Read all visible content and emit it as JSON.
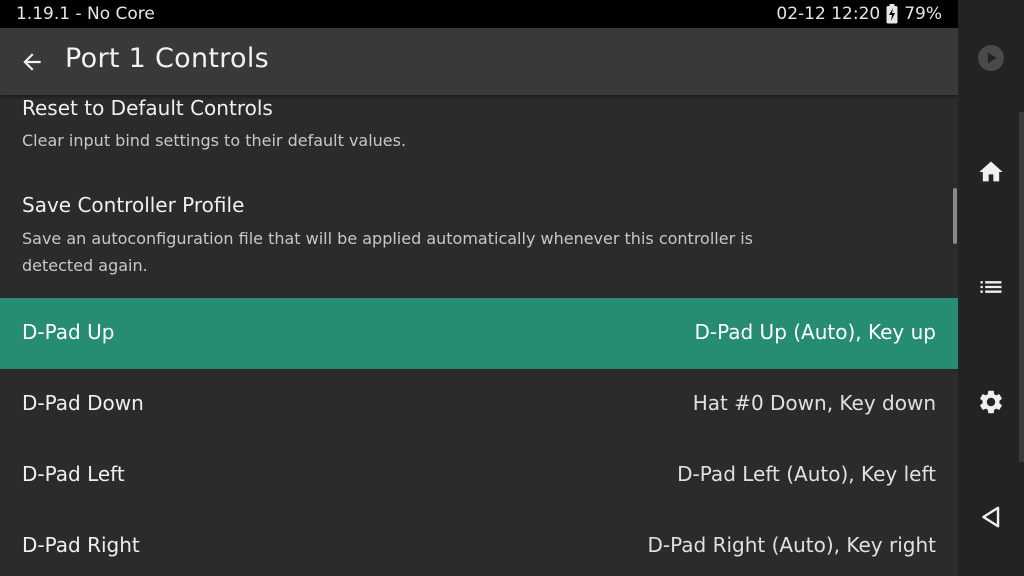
{
  "status_bar": {
    "app_status": "1.19.1 - No Core",
    "datetime": "02-12 12:20",
    "battery": "79%"
  },
  "app_bar": {
    "title": "Port 1 Controls",
    "back_icon": "arrow-left-icon"
  },
  "preferences": [
    {
      "title": "Reset to Default Controls",
      "summary": "Clear input bind settings to their default values."
    },
    {
      "title": "Save Controller Profile",
      "summary": "Save an autoconfiguration file that will be applied automatically whenever this controller is detected again."
    }
  ],
  "binds": [
    {
      "label": "D-Pad Up",
      "value": "D-Pad Up (Auto), Key up",
      "selected": true
    },
    {
      "label": "D-Pad Down",
      "value": "Hat #0 Down, Key down",
      "selected": false
    },
    {
      "label": "D-Pad Left",
      "value": "D-Pad Left (Auto), Key left",
      "selected": false
    },
    {
      "label": "D-Pad Right",
      "value": "D-Pad Right (Auto), Key right",
      "selected": false
    }
  ],
  "side_nav": {
    "buttons": [
      "play-icon",
      "home-icon",
      "list-icon",
      "gear-icon",
      "back-triangle-icon"
    ]
  },
  "colors": {
    "accent": "#268c74",
    "background": "#2b2b2b",
    "app_bar": "#393939"
  }
}
